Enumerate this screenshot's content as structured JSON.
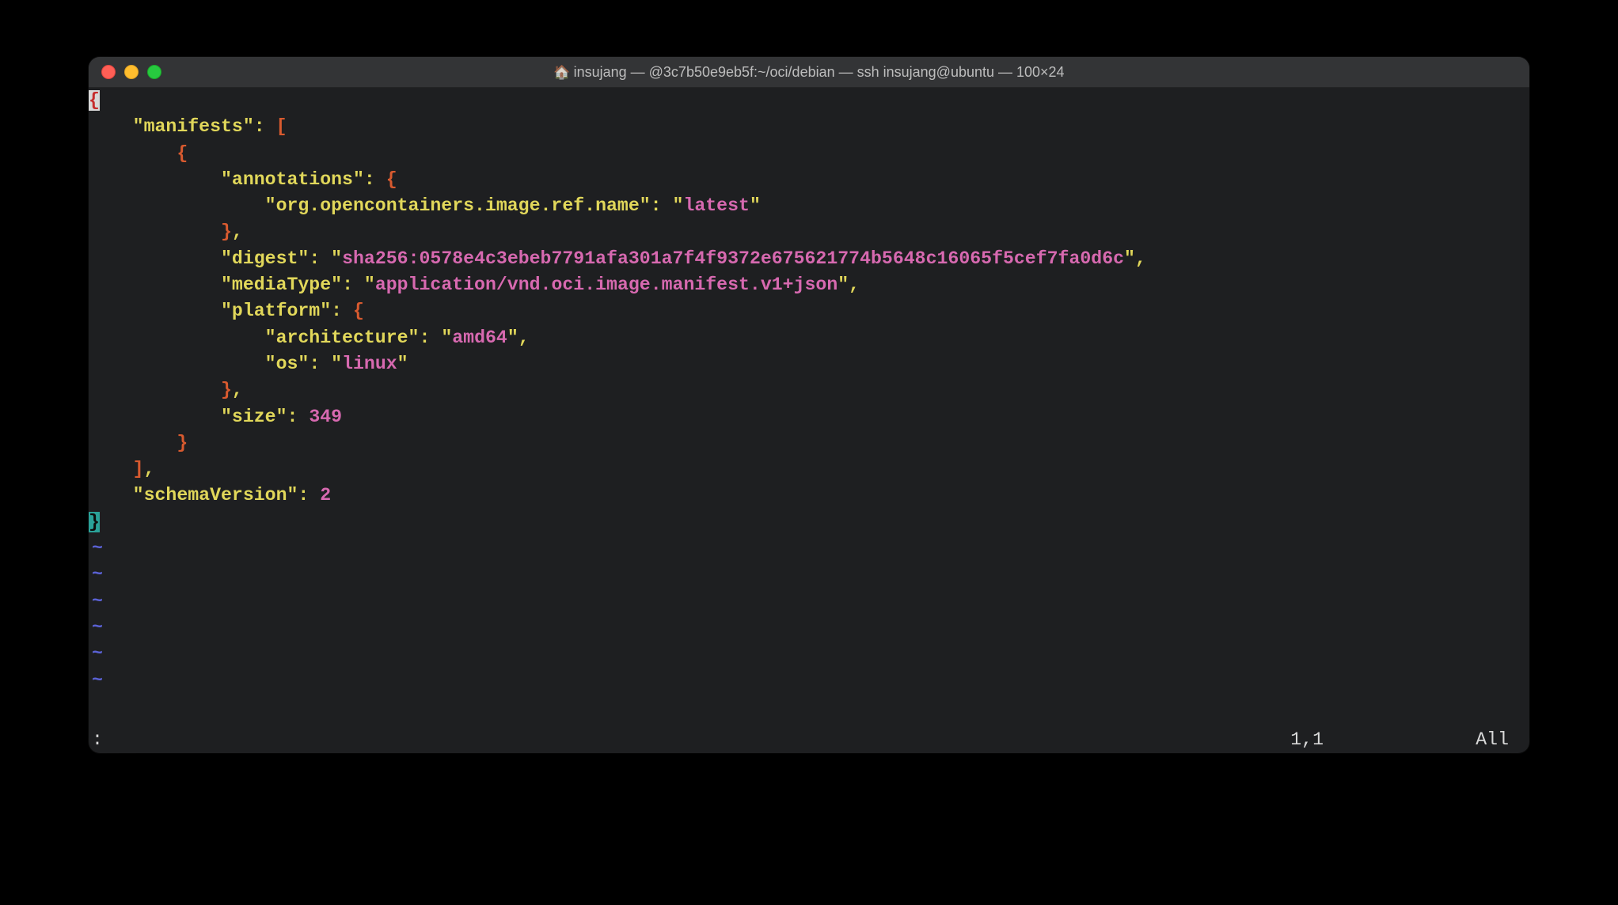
{
  "window": {
    "title": "insujang — @3c7b50e9eb5f:~/oci/debian — ssh insujang@ubuntu — 100×24"
  },
  "json_content": {
    "key_manifests": "manifests",
    "key_annotations": "annotations",
    "key_ref_name": "org.opencontainers.image.ref.name",
    "val_ref_name": "latest",
    "key_digest": "digest",
    "val_digest": "sha256:0578e4c3ebeb7791afa301a7f4f9372e675621774b5648c16065f5cef7fa0d6c",
    "key_mediaType": "mediaType",
    "val_mediaType": "application/vnd.oci.image.manifest.v1+json",
    "key_platform": "platform",
    "key_architecture": "architecture",
    "val_architecture": "amd64",
    "key_os": "os",
    "val_os": "linux",
    "key_size": "size",
    "val_size": "349",
    "key_schemaVersion": "schemaVersion",
    "val_schemaVersion": "2",
    "brace_open": "{",
    "brace_close": "}",
    "bracket_open": "[",
    "bracket_close": "]",
    "comma": ",",
    "colon": ":",
    "quote": "\"",
    "tilde": "~"
  },
  "status": {
    "left": ":",
    "pos": "1,1",
    "right": "All"
  }
}
